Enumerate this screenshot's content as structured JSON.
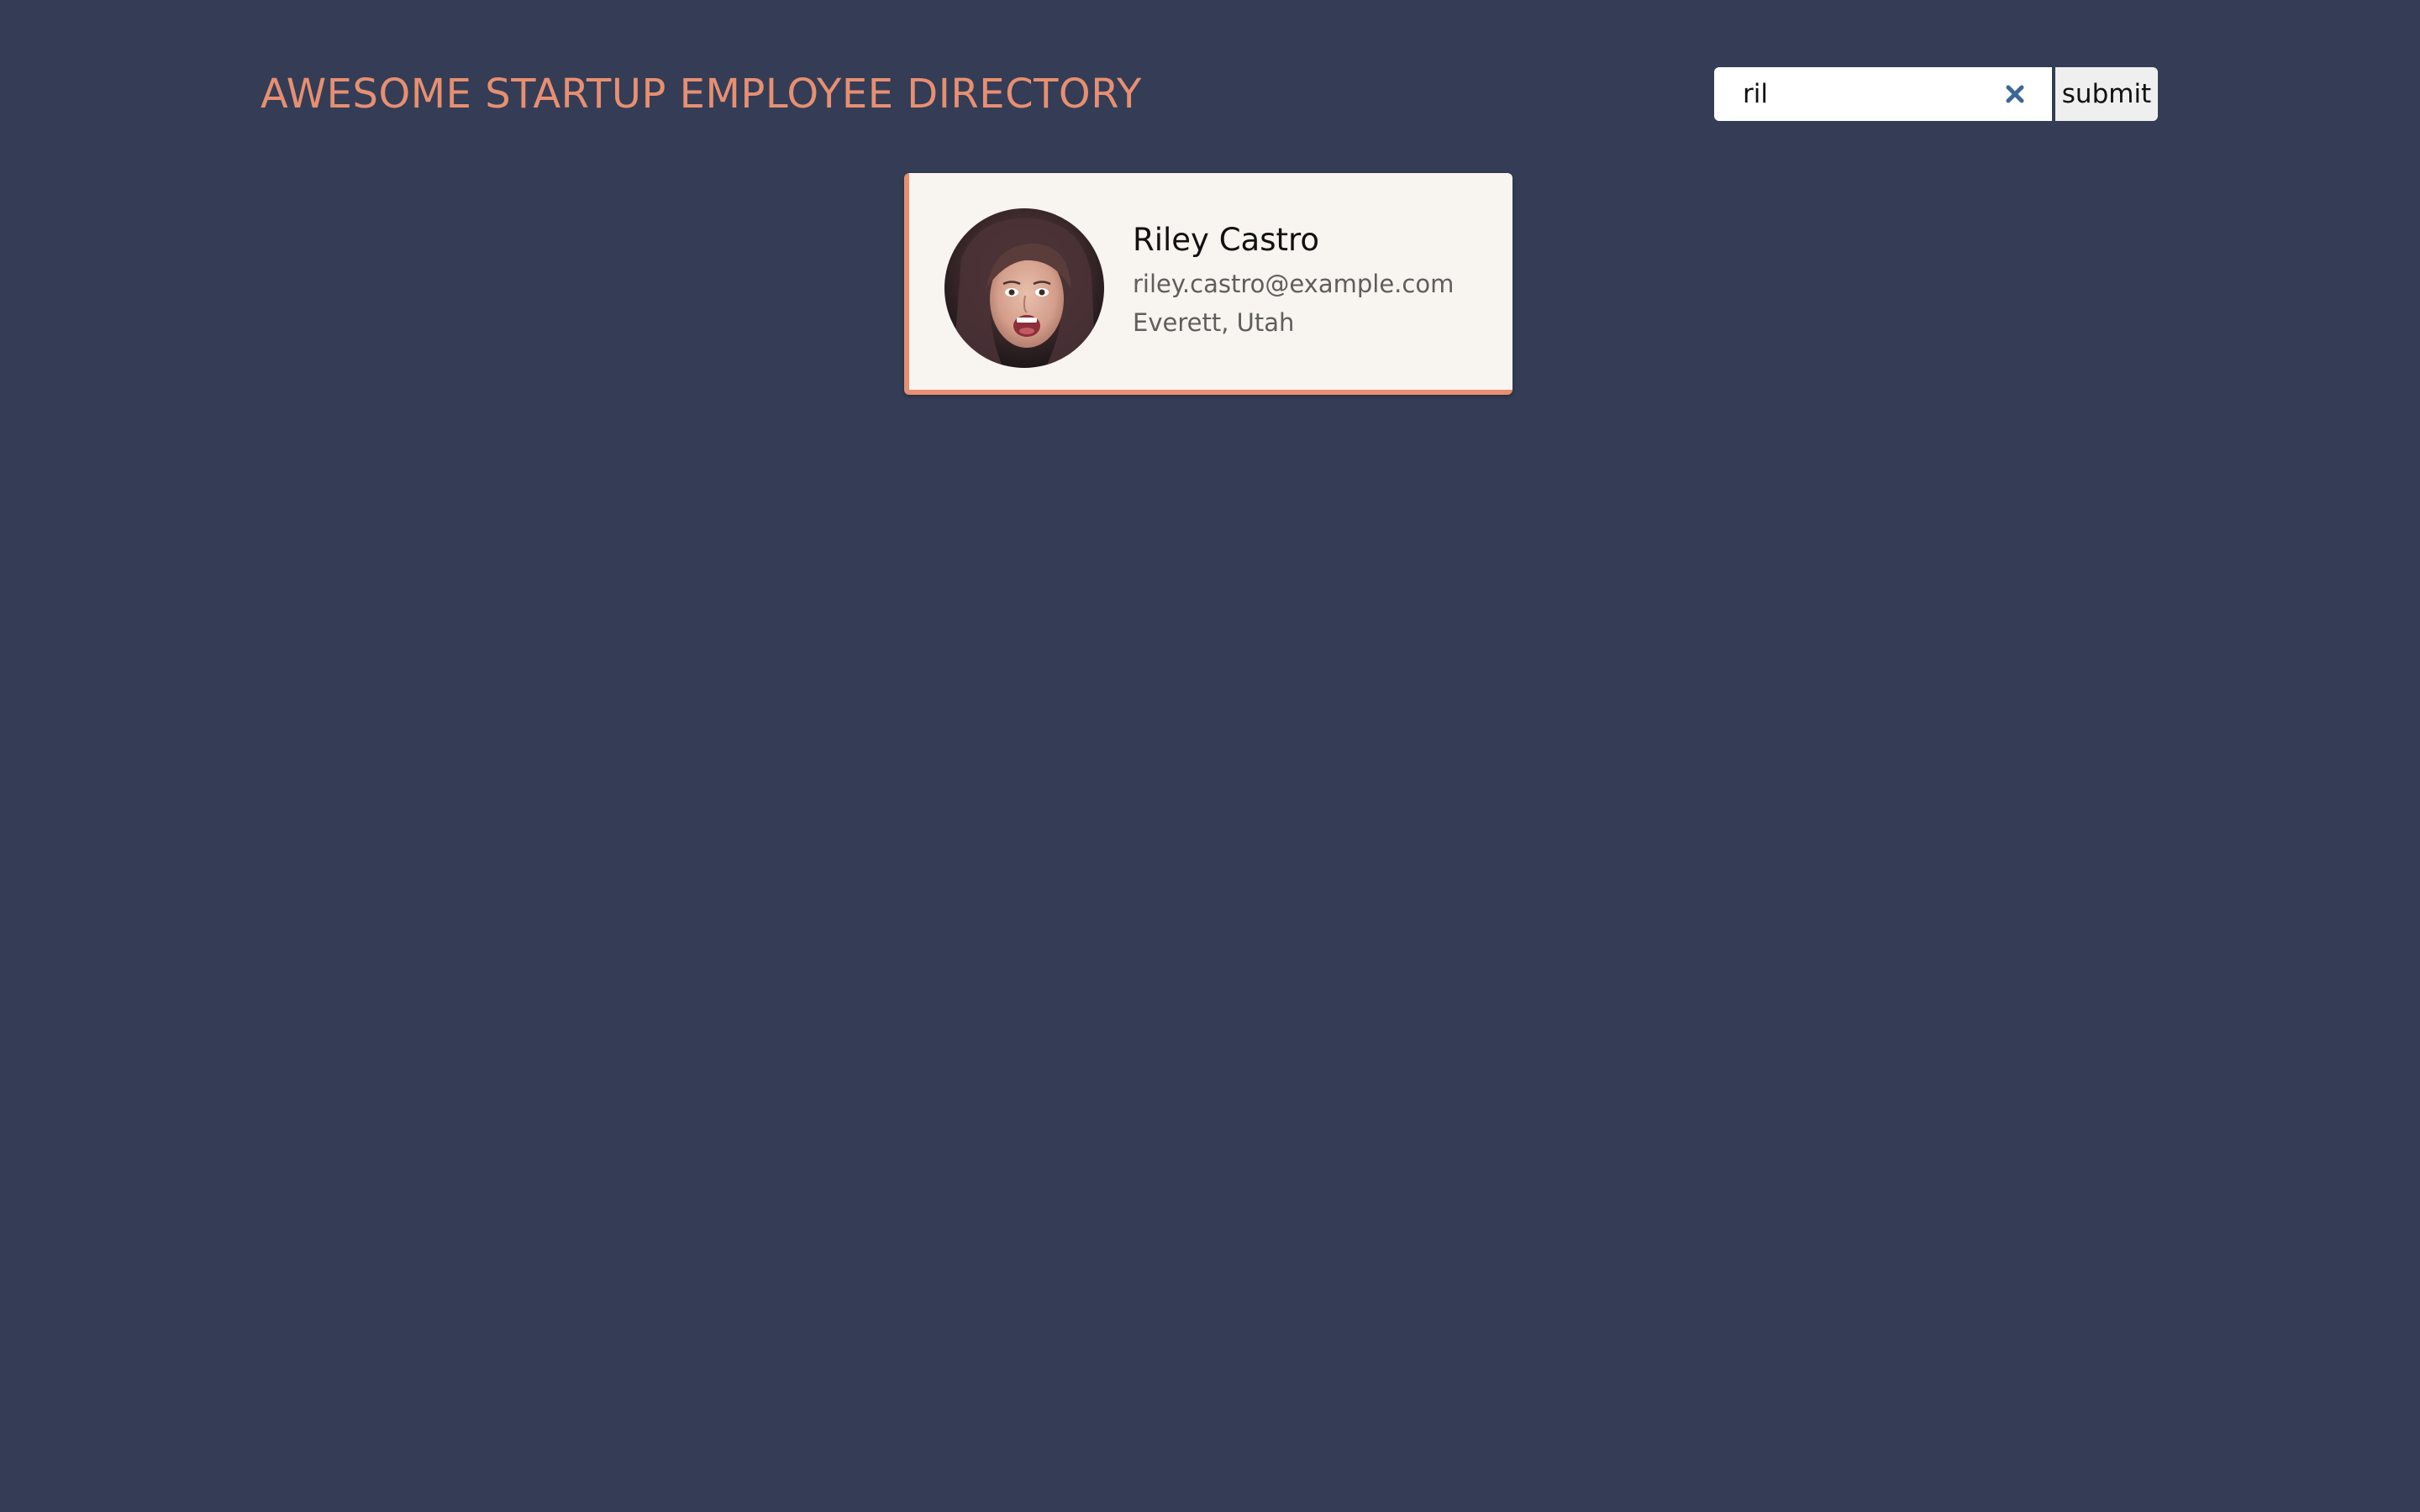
{
  "header": {
    "title": "AWESOME STARTUP EMPLOYEE DIRECTORY"
  },
  "search": {
    "value": "ril",
    "placeholder": "",
    "clear_icon": "close-icon",
    "submit_label": "submit"
  },
  "results": [
    {
      "name": "Riley Castro",
      "email": "riley.castro@example.com",
      "location": "Everett, Utah"
    }
  ],
  "colors": {
    "background": "#343d55",
    "accent": "#e78f72",
    "card_background": "#f8f4ef",
    "clear_icon": "#3d6896"
  }
}
